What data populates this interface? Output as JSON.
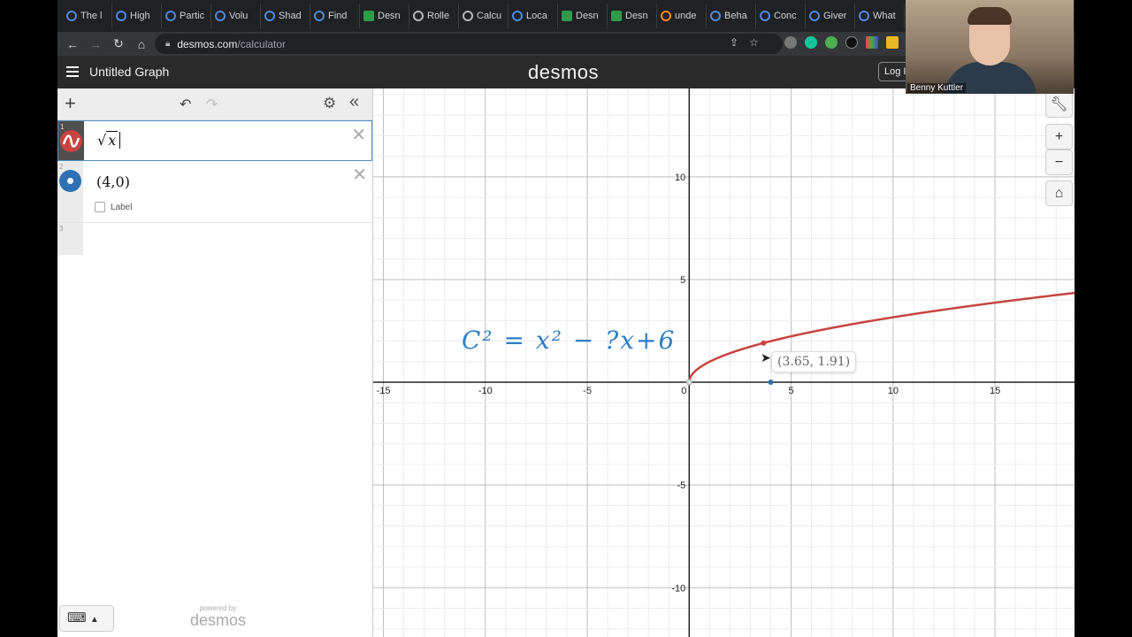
{
  "browser": {
    "tabs": [
      {
        "label": "The l",
        "icon": "desmos-icon"
      },
      {
        "label": "High",
        "icon": "desmos-icon"
      },
      {
        "label": "Partic",
        "icon": "desmos-icon"
      },
      {
        "label": "Volu",
        "icon": "desmos-icon"
      },
      {
        "label": "Shad",
        "icon": "desmos-icon"
      },
      {
        "label": "Find",
        "icon": "desmos-icon"
      },
      {
        "label": "Desn",
        "icon": "desmos-green-icon"
      },
      {
        "label": "Rolle",
        "icon": "globe-icon"
      },
      {
        "label": "Calcu",
        "icon": "globe-icon"
      },
      {
        "label": "Loca",
        "icon": "desmos-icon"
      },
      {
        "label": "Desn",
        "icon": "desmos-green-icon"
      },
      {
        "label": "Desn",
        "icon": "desmos-green-icon"
      },
      {
        "label": "unde",
        "icon": "circle-orange-icon"
      },
      {
        "label": "Beha",
        "icon": "desmos-icon"
      },
      {
        "label": "Conc",
        "icon": "desmos-icon"
      },
      {
        "label": "Giver",
        "icon": "desmos-icon"
      },
      {
        "label": "What",
        "icon": "desmos-icon"
      }
    ],
    "url_domain": "desmos.com",
    "url_path": "/calculator"
  },
  "header": {
    "title": "Untitled Graph",
    "logo": "desmos",
    "login": "Log I"
  },
  "expressions": [
    {
      "index": "1",
      "latex_prefix": "√",
      "latex_var": "x",
      "color": "#c74440",
      "icon": "curve-icon"
    },
    {
      "index": "2",
      "latex": "(4,0)",
      "color": "#2d70b3",
      "icon": "point-icon",
      "label_checkbox": "Label"
    },
    {
      "index": "3"
    }
  ],
  "footer": {
    "powered": "powered by",
    "brand": "desmos"
  },
  "graph": {
    "x_ticks": [
      "-15",
      "-10",
      "-5",
      "0",
      "5",
      "10",
      "15"
    ],
    "y_ticks": [
      "10",
      "5",
      "-5",
      "-10"
    ],
    "tooltip": "(3.65, 1.91)",
    "annotation": "C² = x² − ?x+6",
    "function": "sqrt(x)",
    "point": [
      4,
      0
    ],
    "traced_point": [
      3.65,
      1.91
    ],
    "xlim": [
      -15.5,
      18.9
    ],
    "ylim": [
      -12.4,
      14.3
    ]
  },
  "webcam": {
    "name": "Benny Kuttler"
  }
}
